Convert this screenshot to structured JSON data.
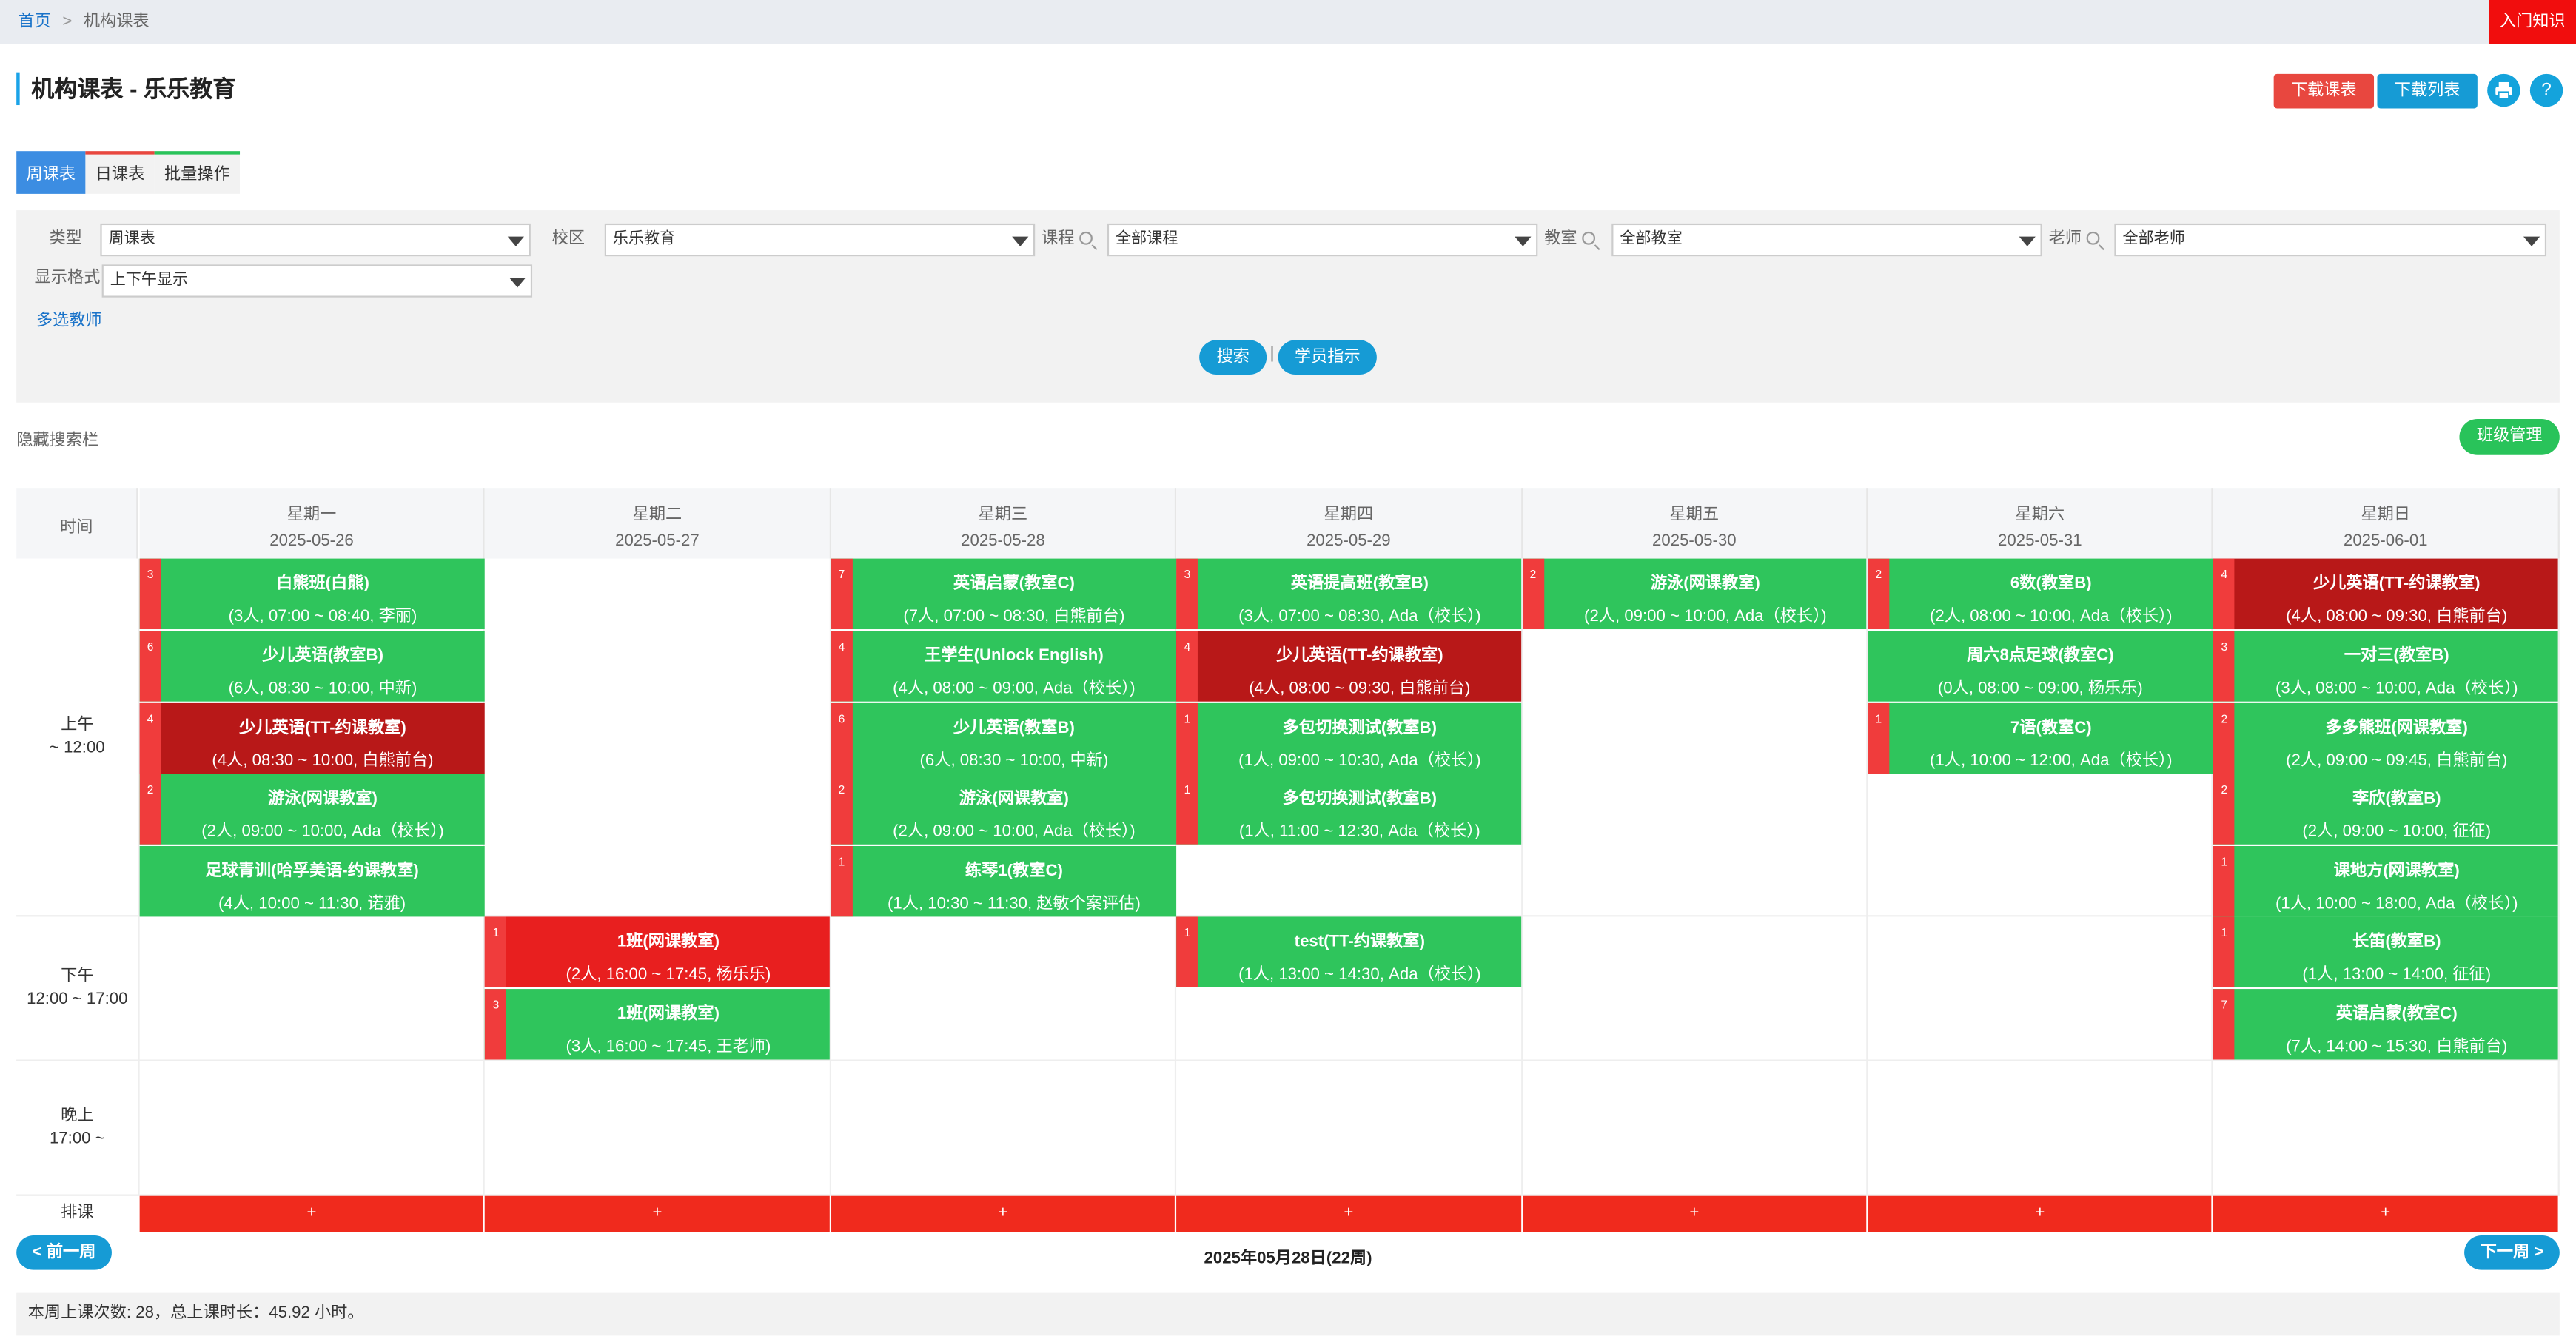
{
  "breadcrumb": {
    "home": "首页",
    "sep": ">",
    "current": "机构课表"
  },
  "intro_label": "入门知识",
  "page_title": "机构课表 - 乐乐教育",
  "toolbar": {
    "download_schedule": "下载课表",
    "download_list": "下载列表",
    "help": "?"
  },
  "tabs": [
    "周课表",
    "日课表",
    "批量操作"
  ],
  "filters": {
    "type": {
      "label": "类型",
      "value": "周课表"
    },
    "campus": {
      "label": "校区",
      "value": "乐乐教育"
    },
    "course": {
      "label": "课程",
      "value": "全部课程"
    },
    "room": {
      "label": "教室",
      "value": "全部教室"
    },
    "teacher": {
      "label": "老师",
      "value": "全部老师"
    },
    "format": {
      "label": "显示格式",
      "value": "上下午显示"
    },
    "multi_teacher": "多选教师",
    "search": "搜索",
    "divider": "|",
    "student_guide": "学员指示"
  },
  "hide_search": "隐藏搜索栏",
  "class_manage": "班级管理",
  "schedule": {
    "time_header": "时间",
    "days": [
      {
        "name": "星期一",
        "date": "2025-05-26"
      },
      {
        "name": "星期二",
        "date": "2025-05-27"
      },
      {
        "name": "星期三",
        "date": "2025-05-28"
      },
      {
        "name": "星期四",
        "date": "2025-05-29"
      },
      {
        "name": "星期五",
        "date": "2025-05-30"
      },
      {
        "name": "星期六",
        "date": "2025-05-31"
      },
      {
        "name": "星期日",
        "date": "2025-06-01"
      }
    ],
    "slots": [
      {
        "name": "上午",
        "range": "~ 12:00"
      },
      {
        "name": "下午",
        "range": "12:00 ~ 17:00"
      },
      {
        "name": "晚上",
        "range": "17:00 ~"
      }
    ],
    "events": [
      {
        "day": 0,
        "slot": 0,
        "row": 0,
        "badge": "3",
        "title": "白熊班(白熊)",
        "detail": "(3人, 07:00 ~ 08:40, 李丽)",
        "color": "#2fc55c"
      },
      {
        "day": 0,
        "slot": 0,
        "row": 1,
        "badge": "6",
        "title": "少儿英语(教室B)",
        "detail": "(6人, 08:30 ~ 10:00, 中新)",
        "color": "#2fc55c"
      },
      {
        "day": 0,
        "slot": 0,
        "row": 2,
        "badge": "4",
        "title": "少儿英语(TT-约课教室)",
        "detail": "(4人, 08:30 ~ 10:00, 白熊前台)",
        "color": "#b81818"
      },
      {
        "day": 0,
        "slot": 0,
        "row": 3,
        "badge": "2",
        "title": "游泳(网课教室)",
        "detail": "(2人, 09:00 ~ 10:00, Ada（校长）)",
        "color": "#2fc55c"
      },
      {
        "day": 0,
        "slot": 0,
        "row": 4,
        "badge": "",
        "title": "足球青训(哈孚美语-约课教室)",
        "detail": "(4人, 10:00 ~ 11:30, 诺雅)",
        "color": "#2fc55c"
      },
      {
        "day": 1,
        "slot": 1,
        "row": 0,
        "badge": "1",
        "title": "1班(网课教室)",
        "detail": "(2人, 16:00 ~ 17:45, 杨乐乐)",
        "color": "#e81f1f"
      },
      {
        "day": 1,
        "slot": 1,
        "row": 1,
        "badge": "3",
        "title": "1班(网课教室)",
        "detail": "(3人, 16:00 ~ 17:45, 王老师)",
        "color": "#2fc55c"
      },
      {
        "day": 2,
        "slot": 0,
        "row": 0,
        "badge": "7",
        "title": "英语启蒙(教室C)",
        "detail": "(7人, 07:00 ~ 08:30, 白熊前台)",
        "color": "#2fc55c"
      },
      {
        "day": 2,
        "slot": 0,
        "row": 1,
        "badge": "4",
        "title": "王学生(Unlock English)",
        "detail": "(4人, 08:00 ~ 09:00, Ada（校长）)",
        "color": "#2fc55c"
      },
      {
        "day": 2,
        "slot": 0,
        "row": 2,
        "badge": "6",
        "title": "少儿英语(教室B)",
        "detail": "(6人, 08:30 ~ 10:00, 中新)",
        "color": "#2fc55c"
      },
      {
        "day": 2,
        "slot": 0,
        "row": 3,
        "badge": "2",
        "title": "游泳(网课教室)",
        "detail": "(2人, 09:00 ~ 10:00, Ada（校长）)",
        "color": "#2fc55c"
      },
      {
        "day": 2,
        "slot": 0,
        "row": 4,
        "badge": "1",
        "title": "练琴1(教室C)",
        "detail": "(1人, 10:30 ~ 11:30, 赵敏个案评估)",
        "color": "#2fc55c"
      },
      {
        "day": 3,
        "slot": 0,
        "row": 0,
        "badge": "3",
        "title": "英语提高班(教室B)",
        "detail": "(3人, 07:00 ~ 08:30, Ada（校长）)",
        "color": "#2fc55c"
      },
      {
        "day": 3,
        "slot": 0,
        "row": 1,
        "badge": "4",
        "title": "少儿英语(TT-约课教室)",
        "detail": "(4人, 08:00 ~ 09:30, 白熊前台)",
        "color": "#b81818"
      },
      {
        "day": 3,
        "slot": 0,
        "row": 2,
        "badge": "1",
        "title": "多包切换测试(教室B)",
        "detail": "(1人, 09:00 ~ 10:30, Ada（校长）)",
        "color": "#2fc55c"
      },
      {
        "day": 3,
        "slot": 0,
        "row": 3,
        "badge": "1",
        "title": "多包切换测试(教室B)",
        "detail": "(1人, 11:00 ~ 12:30, Ada（校长）)",
        "color": "#2fc55c"
      },
      {
        "day": 3,
        "slot": 1,
        "row": 0,
        "badge": "1",
        "title": "test(TT-约课教室)",
        "detail": "(1人, 13:00 ~ 14:30, Ada（校长）)",
        "color": "#2fc55c"
      },
      {
        "day": 4,
        "slot": 0,
        "row": 0,
        "badge": "2",
        "title": "游泳(网课教室)",
        "detail": "(2人, 09:00 ~ 10:00, Ada（校长）)",
        "color": "#2fc55c"
      },
      {
        "day": 5,
        "slot": 0,
        "row": 0,
        "badge": "2",
        "title": "6数(教室B)",
        "detail": "(2人, 08:00 ~ 10:00, Ada（校长）)",
        "color": "#2fc55c"
      },
      {
        "day": 5,
        "slot": 0,
        "row": 1,
        "badge": "",
        "title": "周六8点足球(教室C)",
        "detail": "(0人, 08:00 ~ 09:00, 杨乐乐)",
        "color": "#2fc55c"
      },
      {
        "day": 5,
        "slot": 0,
        "row": 2,
        "badge": "1",
        "title": "7语(教室C)",
        "detail": "(1人, 10:00 ~ 12:00, Ada（校长）)",
        "color": "#2fc55c"
      },
      {
        "day": 6,
        "slot": 0,
        "row": 0,
        "badge": "4",
        "title": "少儿英语(TT-约课教室)",
        "detail": "(4人, 08:00 ~ 09:30, 白熊前台)",
        "color": "#b81818"
      },
      {
        "day": 6,
        "slot": 0,
        "row": 1,
        "badge": "3",
        "title": "一对三(教室B)",
        "detail": "(3人, 08:00 ~ 10:00, Ada（校长）)",
        "color": "#2fc55c"
      },
      {
        "day": 6,
        "slot": 0,
        "row": 2,
        "badge": "2",
        "title": "多多熊班(网课教室)",
        "detail": "(2人, 09:00 ~ 09:45, 白熊前台)",
        "color": "#2fc55c"
      },
      {
        "day": 6,
        "slot": 0,
        "row": 3,
        "badge": "2",
        "title": "李欣(教室B)",
        "detail": "(2人, 09:00 ~ 10:00, 征征)",
        "color": "#2fc55c"
      },
      {
        "day": 6,
        "slot": 0,
        "row": 4,
        "badge": "1",
        "title": "课地方(网课教室)",
        "detail": "(1人, 10:00 ~ 18:00, Ada（校长）)",
        "color": "#2fc55c"
      },
      {
        "day": 6,
        "slot": 1,
        "row": 0,
        "badge": "1",
        "title": "长笛(教室B)",
        "detail": "(1人, 13:00 ~ 14:00, 征征)",
        "color": "#2fc55c"
      },
      {
        "day": 6,
        "slot": 1,
        "row": 1,
        "badge": "7",
        "title": "英语启蒙(教室C)",
        "detail": "(7人, 14:00 ~ 15:30, 白熊前台)",
        "color": "#2fc55c"
      }
    ],
    "add_label": "排课",
    "plus": "+"
  },
  "nav": {
    "prev": "< 前一周",
    "next": "下一周 >",
    "current": "2025年05月28日(22周)"
  },
  "stats": "本周上课次数: 28，总上课时长：45.92 小时。"
}
